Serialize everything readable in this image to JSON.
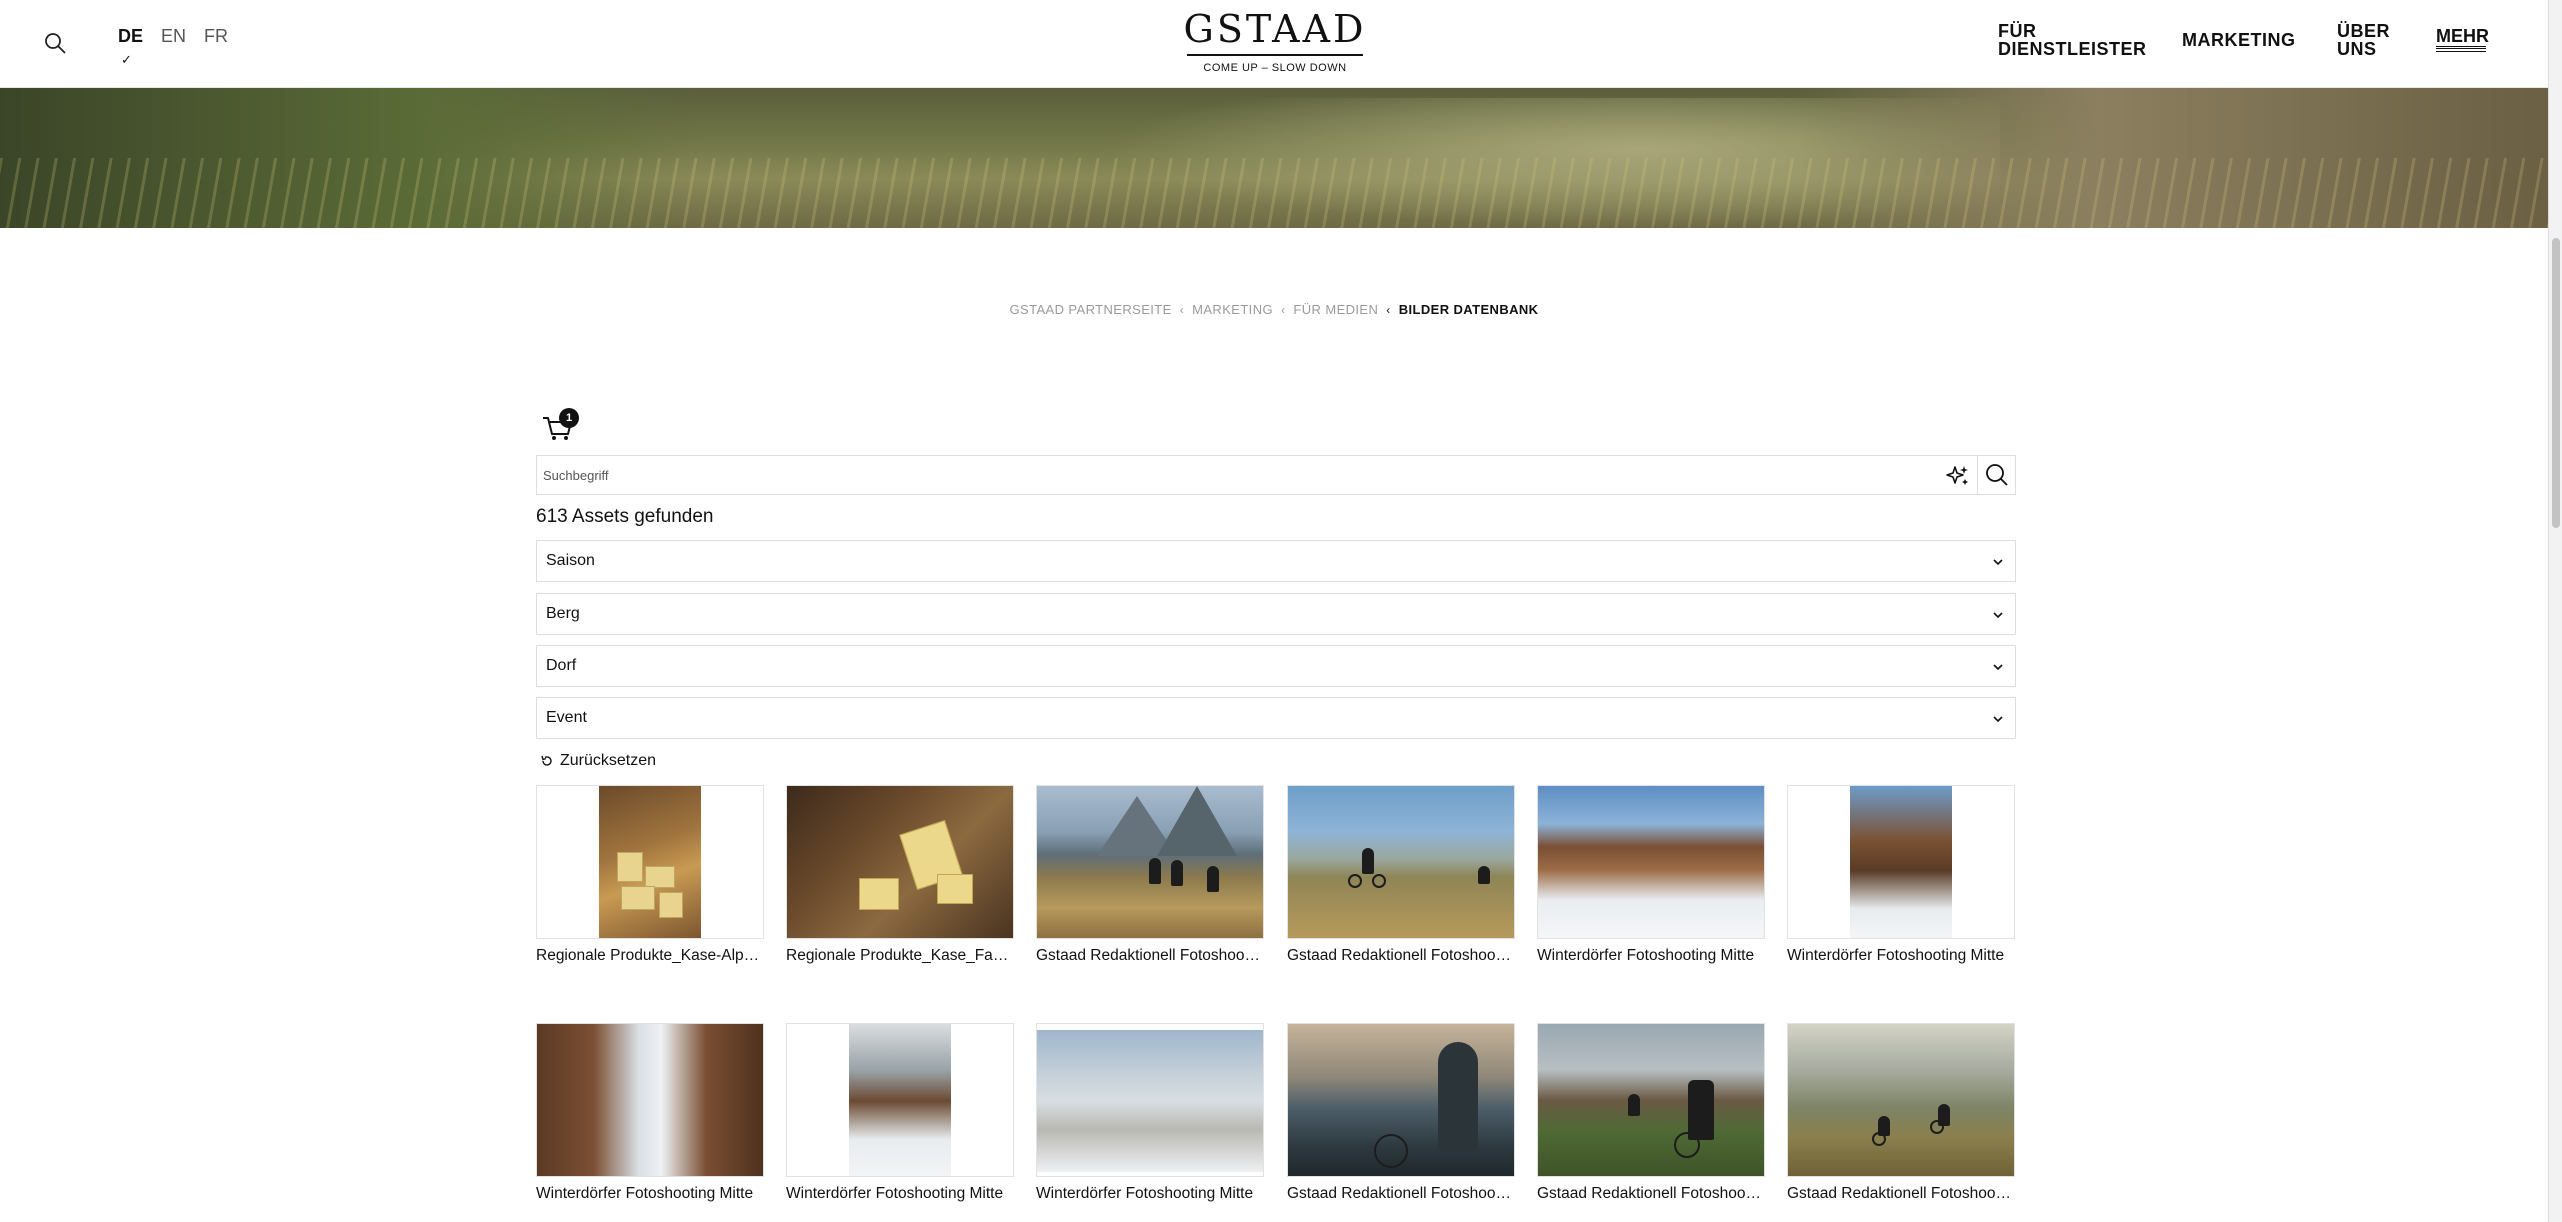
{
  "header": {
    "languages": [
      {
        "code": "DE",
        "active": true
      },
      {
        "code": "EN",
        "active": false
      },
      {
        "code": "FR",
        "active": false
      }
    ],
    "logo": {
      "word": "GSTAAD",
      "tagline": "COME UP – SLOW DOWN"
    },
    "nav": {
      "dienstleister_line1": "FÜR",
      "dienstleister_line2": "DIENSTLEISTER",
      "marketing": "MARKETING",
      "uber_line1": "ÜBER",
      "uber_line2": "UNS",
      "mehr": "MEHR"
    }
  },
  "breadcrumb": {
    "items": [
      "GSTAAD PARTNERSEITE",
      "MARKETING",
      "FÜR MEDIEN"
    ],
    "current": "BILDER DATENBANK"
  },
  "cart": {
    "count": "1"
  },
  "search": {
    "placeholder": "Suchbegriff",
    "value": ""
  },
  "results": {
    "count_text": "613 Assets gefunden"
  },
  "filters": [
    "Saison",
    "Berg",
    "Dorf",
    "Event"
  ],
  "reset_label": "Zurücksetzen",
  "assets": [
    "Regionale Produkte_Kase-Alpkase-Fondue",
    "Regionale Produkte_Kase_Familie",
    "Gstaad Redaktionell Fotoshooting Mountainbike",
    "Gstaad Redaktionell Fotoshooting Mountainbike",
    "Winterdörfer Fotoshooting Mitte",
    "Winterdörfer Fotoshooting Mitte",
    "Winterdörfer Fotoshooting Mitte",
    "Winterdörfer Fotoshooting Mitte",
    "Winterdörfer Fotoshooting Mitte",
    "Gstaad Redaktionell Fotoshooting Mountainbike",
    "Gstaad Redaktionell Fotoshooting Mountainbike",
    "Gstaad Redaktionell Fotoshooting Mountainbike"
  ],
  "icons": {
    "search": "search-icon",
    "cart": "cart-icon",
    "ai": "sparkle-icon",
    "chevron": "chevron-down-icon",
    "reset": "reset-icon"
  }
}
